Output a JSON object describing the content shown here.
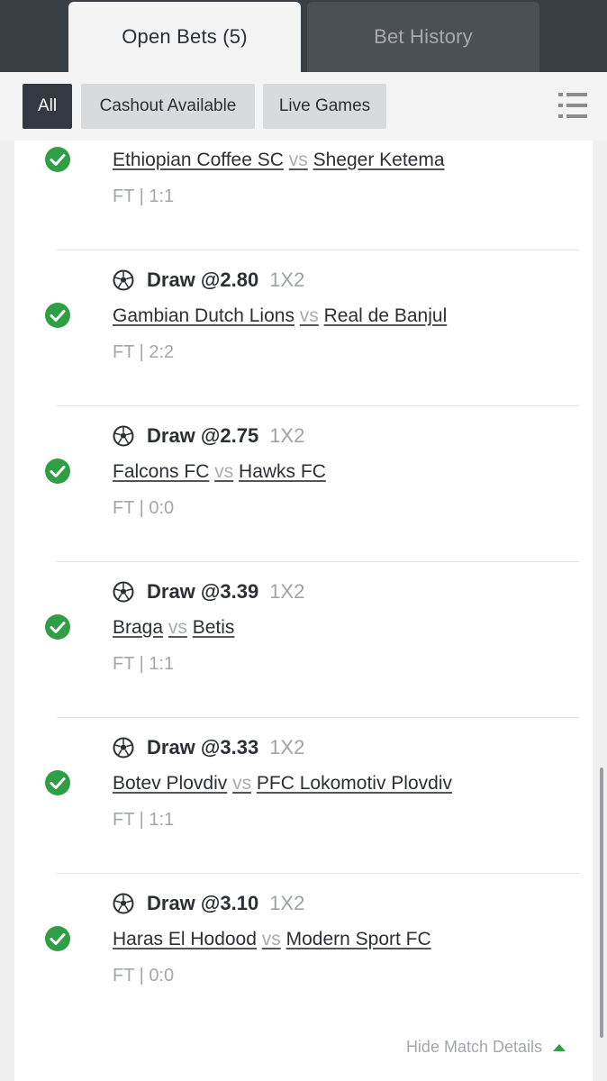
{
  "tabs": {
    "open_bets": "Open Bets (5)",
    "bet_history": "Bet History"
  },
  "filters": {
    "all": "All",
    "cashout": "Cashout Available",
    "live": "Live Games"
  },
  "bets": [
    {
      "selection": "",
      "market": "",
      "home": "Ethiopian Coffee SC",
      "vs": "vs",
      "away": "Sheger Ketema",
      "result": "FT | 1:1"
    },
    {
      "selection": "Draw @2.80",
      "market": "1X2",
      "home": "Gambian Dutch Lions",
      "vs": "vs",
      "away": "Real de Banjul",
      "result": "FT | 2:2"
    },
    {
      "selection": "Draw @2.75",
      "market": "1X2",
      "home": "Falcons FC",
      "vs": "vs",
      "away": "Hawks FC",
      "result": "FT | 0:0"
    },
    {
      "selection": "Draw @3.39",
      "market": "1X2",
      "home": "Braga",
      "vs": "vs",
      "away": "Betis",
      "result": "FT | 1:1"
    },
    {
      "selection": "Draw @3.33",
      "market": "1X2",
      "home": "Botev Plovdiv",
      "vs": "vs",
      "away": "PFC Lokomotiv Plovdiv",
      "result": "FT | 1:1"
    },
    {
      "selection": "Draw @3.10",
      "market": "1X2",
      "home": "Haras El Hodood",
      "vs": "vs",
      "away": "Modern Sport FC",
      "result": "FT | 0:0"
    }
  ],
  "footer": {
    "hide_details": "Hide Match Details"
  },
  "colors": {
    "accent_green": "#2f9e44",
    "dark": "#343840"
  },
  "icons": {
    "status": "check-circle-icon",
    "sport": "soccer-ball-icon",
    "menu": "list-icon"
  }
}
